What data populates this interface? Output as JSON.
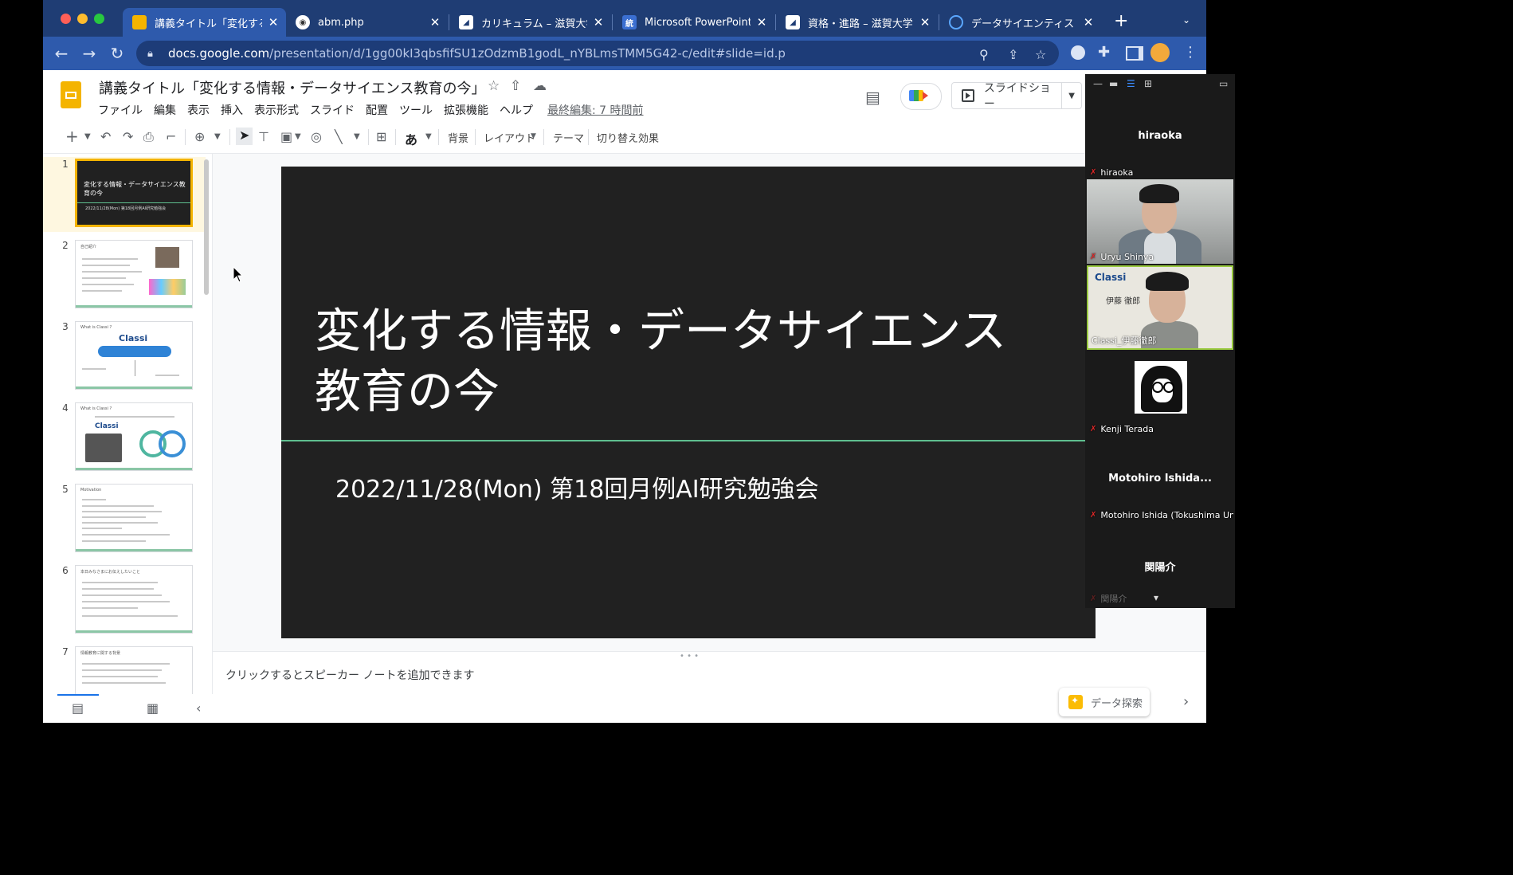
{
  "browser": {
    "tabs": [
      {
        "title": "講義タイトル「変化する情報・",
        "icon": "slides-icon",
        "active": true
      },
      {
        "title": "abm.php",
        "icon": "globe-icon"
      },
      {
        "title": "カリキュラム – 滋賀大学",
        "icon": "shiga-icon"
      },
      {
        "title": "Microsoft PowerPoint",
        "icon": "stat-icon"
      },
      {
        "title": "資格・進路 – 滋賀大学 デ",
        "icon": "shiga-icon"
      },
      {
        "title": "データサイエンティスト",
        "icon": "edge-icon"
      }
    ],
    "url_domain": "docs.google.com",
    "url_path": "/presentation/d/1gg00kI3qbsfifSU1zOdzmB1godL_nYBLmsTMM5G42-c/edit#slide=id.p"
  },
  "docs": {
    "title": "講義タイトル「変化する情報・データサイエンス教育の今」",
    "menus": [
      "ファイル",
      "編集",
      "表示",
      "挿入",
      "表示形式",
      "スライド",
      "配置",
      "ツール",
      "拡張機能",
      "ヘルプ"
    ],
    "last_edit": "最終編集: 7 時間前",
    "slideshow_label": "スライドショー"
  },
  "toolbar": {
    "font_glyph": "あ",
    "background": "背景",
    "layout": "レイアウト",
    "theme": "テーマ",
    "transition": "切り替え効果"
  },
  "filmstrip": {
    "slides": [
      {
        "num": "1",
        "title": "変化する情報・データサイエンス教育の今",
        "sub": "2022/11/28(Mon) 第18回月例AI研究勉強会"
      },
      {
        "num": "2",
        "head": "自己紹介"
      },
      {
        "num": "3",
        "head": "What is Classi ?",
        "brand": "Classi"
      },
      {
        "num": "4",
        "head": "What is Classi ?",
        "brand": "Classi"
      },
      {
        "num": "5",
        "head": "Motivation"
      },
      {
        "num": "6",
        "head": "本日みなさまにお伝えしたいこと"
      },
      {
        "num": "7",
        "head": "情報教育に関する背景"
      }
    ]
  },
  "slide": {
    "title_line1": "変化する情報・データサイエンス",
    "title_line2": "教育の今",
    "subtitle": "2022/11/28(Mon) 第18回月例AI研究勉強会"
  },
  "notes": {
    "placeholder": "クリックするとスピーカー ノートを追加できます",
    "explore_label": "データ探索"
  },
  "zoom": {
    "participants": [
      {
        "display": "hiraoka",
        "label": "hiraoka",
        "video": false
      },
      {
        "label": "Uryu Shinya",
        "video": true
      },
      {
        "label": "Classi_伊藤徹郎",
        "video": true,
        "overlay_brand": "Classi",
        "overlay_name": "伊藤 徹郎"
      },
      {
        "label": "Kenji Terada",
        "video": false,
        "avatar": true
      },
      {
        "display": "Motohiro Ishida...",
        "label": "Motohiro Ishida (Tokushima Univ.)",
        "video": false
      },
      {
        "display": "関陽介",
        "label": "関陽介",
        "video": false
      }
    ]
  },
  "colors": {
    "tab_bar": "#1f3d74",
    "address_bar": "#2e5aac",
    "slide_bg": "#212121",
    "accent_rule": "#5fbf8f",
    "slides_yellow": "#f4b400"
  }
}
